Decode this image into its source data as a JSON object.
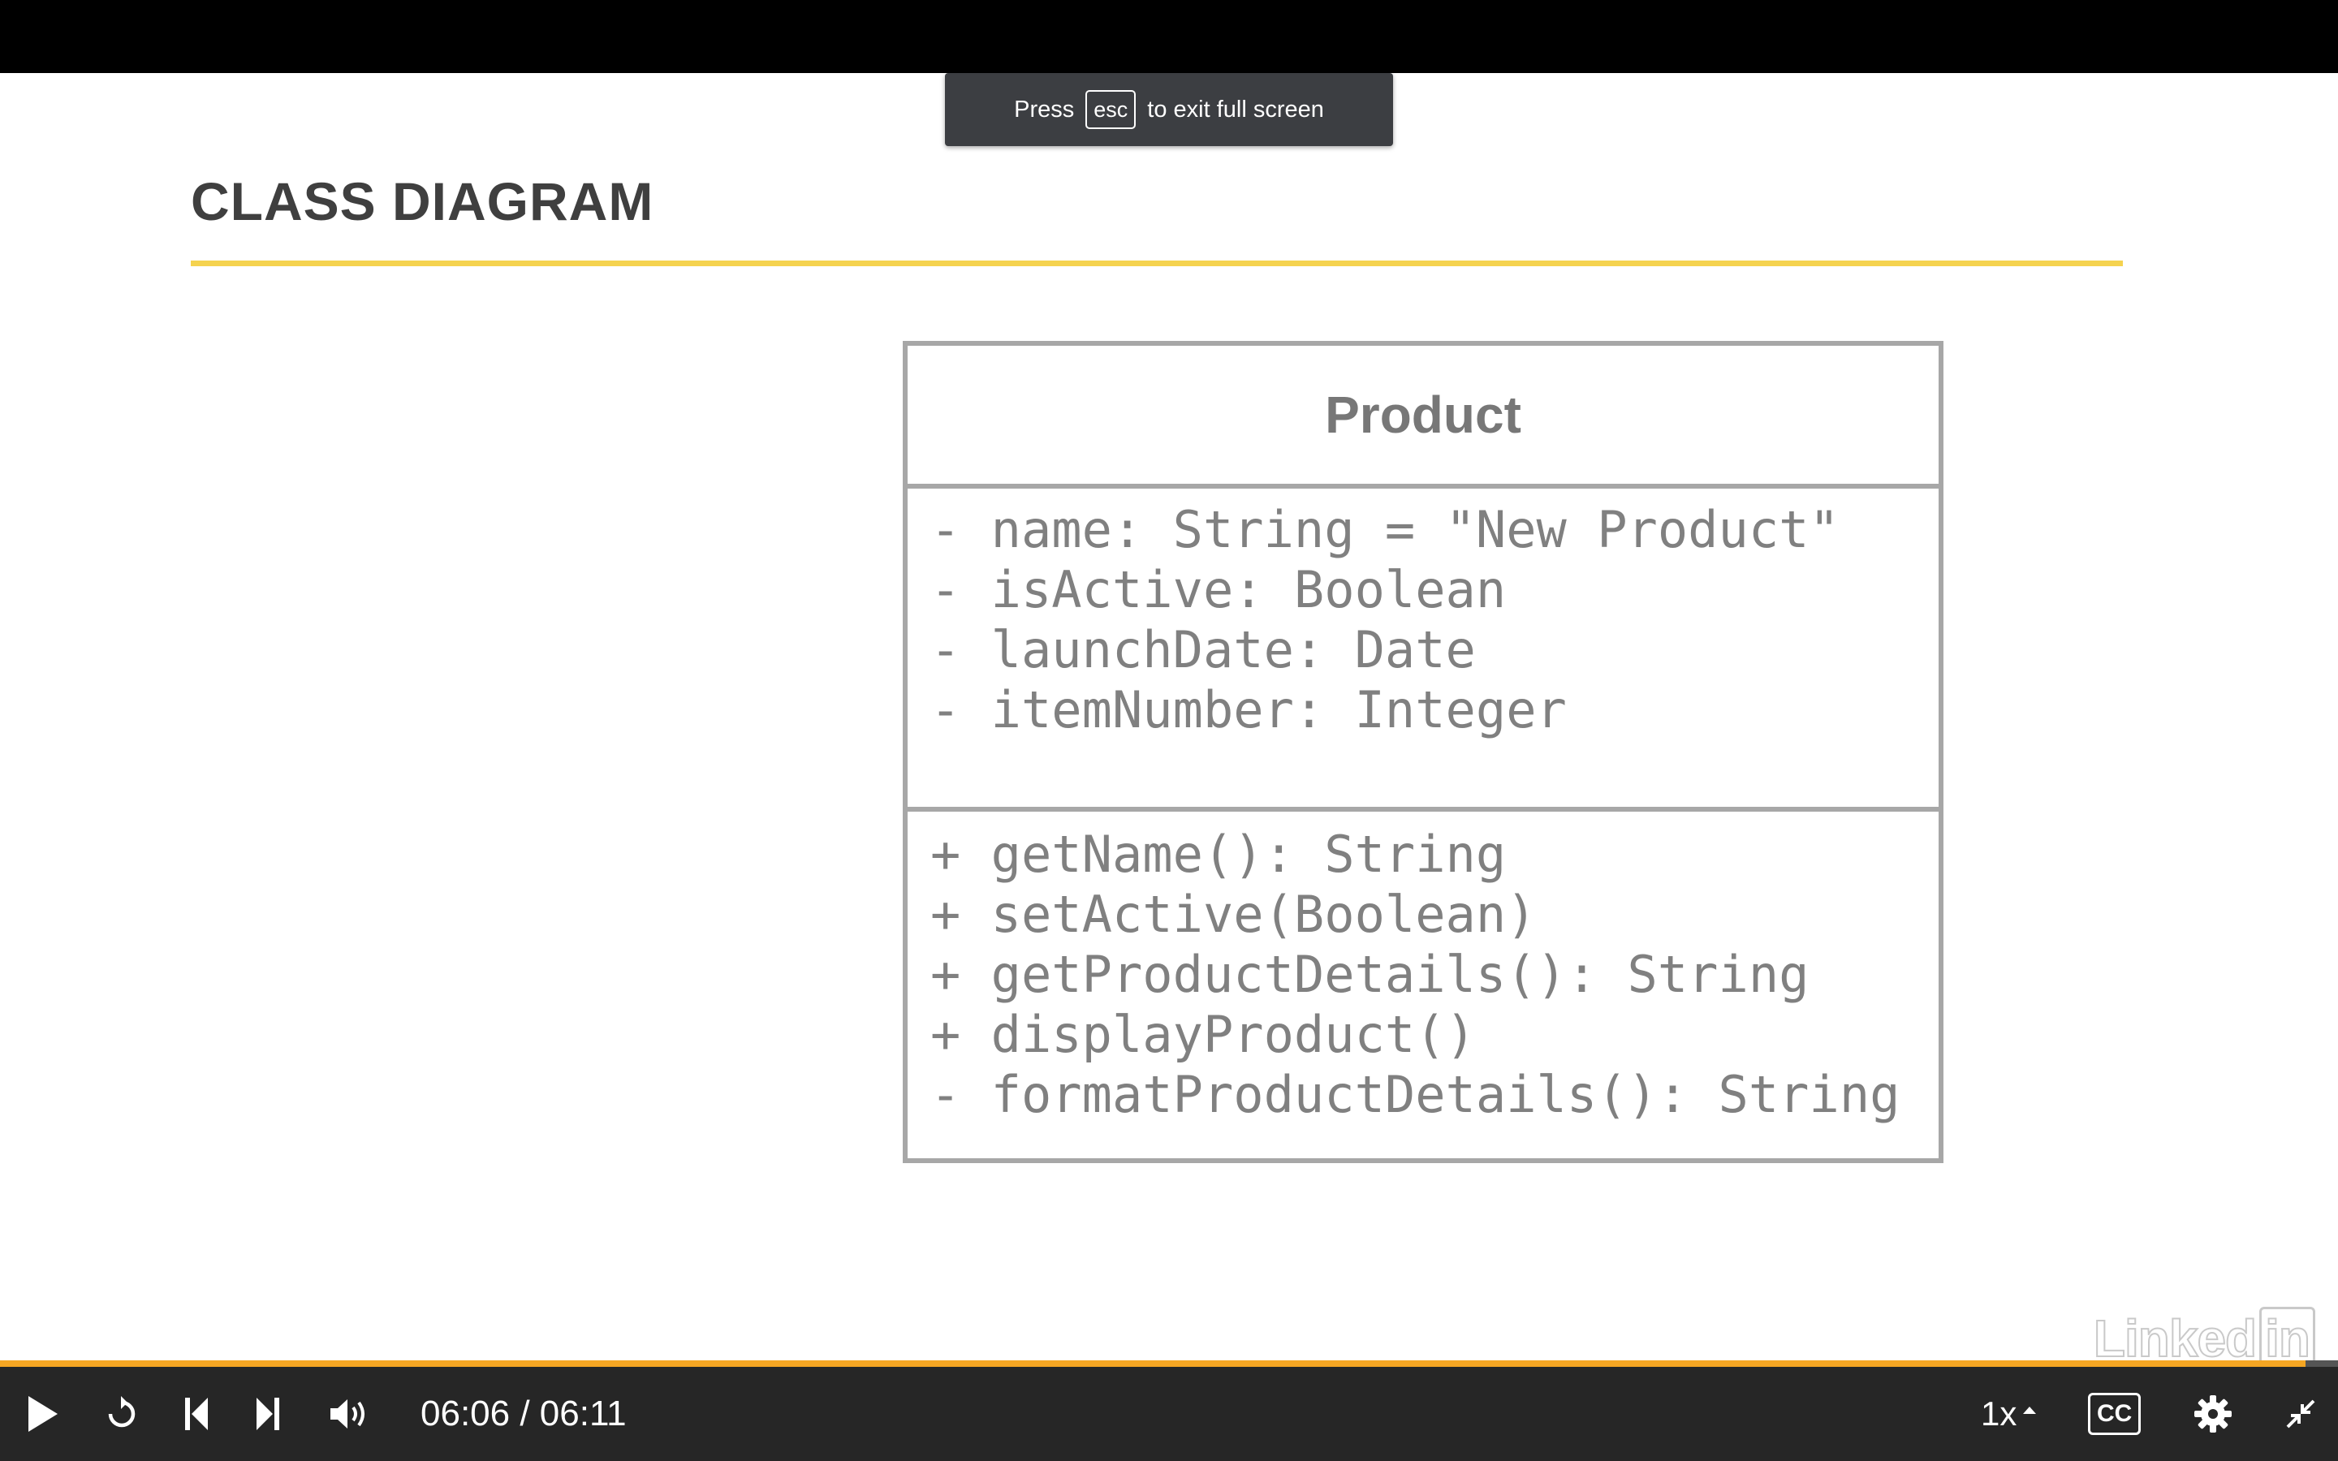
{
  "toast": {
    "prefix": "Press",
    "key": "esc",
    "suffix": "to exit full screen"
  },
  "slide": {
    "title": "CLASS DIAGRAM",
    "class_name": "Product",
    "attributes": [
      "- name: String = \"New Product\"",
      "- isActive: Boolean",
      "- launchDate: Date",
      "- itemNumber: Integer"
    ],
    "operations": [
      "+ getName(): String",
      "+ setActive(Boolean)",
      "+ getProductDetails(): String",
      "+ displayProduct()",
      "- formatProductDetails(): String"
    ]
  },
  "player": {
    "time": "06:06 / 06:11",
    "progress": 0.986,
    "speed": "1x",
    "cc_label": "CC",
    "accent_color": "#f5a623",
    "watermark": "LinkedIn"
  },
  "colors": {
    "title_rule": "#f5d34f",
    "control_bar": "#262626",
    "uml_border": "#a7a7a7"
  }
}
